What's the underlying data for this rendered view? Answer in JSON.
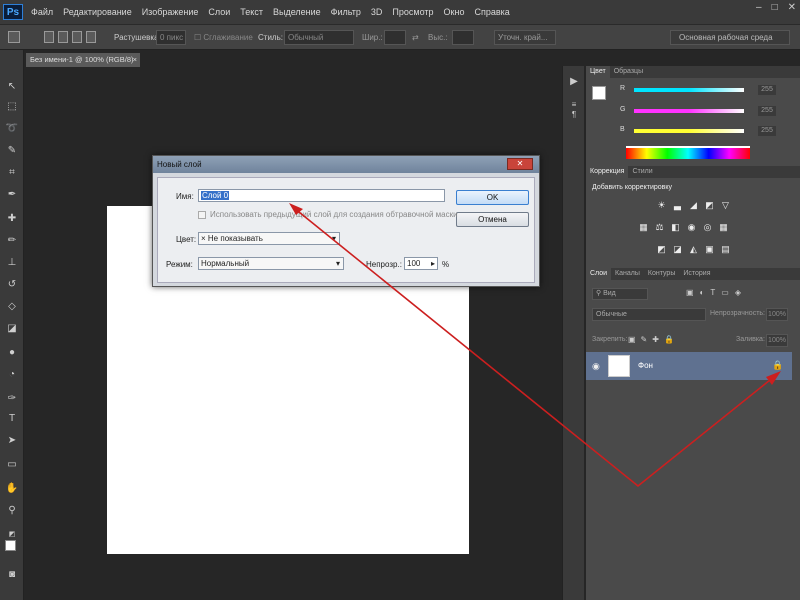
{
  "app": {
    "logo": "Ps"
  },
  "menu": [
    "Файл",
    "Редактирование",
    "Изображение",
    "Слои",
    "Текст",
    "Выделение",
    "Фильтр",
    "3D",
    "Просмотр",
    "Окно",
    "Справка"
  ],
  "window_controls": {
    "minimize": "–",
    "maximize": "□",
    "close": "✕"
  },
  "options_bar": {
    "feather_label": "Растушевка:",
    "feather_value": "0 пикс",
    "antialias_label": "Сглаживание",
    "style_label": "Стиль:",
    "style_value": "Обычный",
    "width_label": "Шир.:",
    "height_label": "Выс.:",
    "refine_button": "Уточн. край...",
    "workspace": "Основная рабочая среда"
  },
  "document_tab": {
    "title": "Без имени-1 @ 100% (RGB/8)",
    "close": "×"
  },
  "color_panel": {
    "tabs": [
      "Цвет",
      "Образцы"
    ],
    "sliders": [
      {
        "label": "R",
        "value": "255",
        "gradient": "#00e5ff"
      },
      {
        "label": "G",
        "value": "255",
        "gradient": "#ff33ff"
      },
      {
        "label": "B",
        "value": "255",
        "gradient": "#ffff33"
      }
    ]
  },
  "adjustments_panel": {
    "tabs": [
      "Коррекция",
      "Стили"
    ],
    "title": "Добавить корректировку"
  },
  "layers_panel": {
    "tabs": [
      "Слои",
      "Каналы",
      "Контуры",
      "История"
    ],
    "filter": "Вид",
    "blend_mode": "Обычные",
    "opacity_label": "Непрозрачность:",
    "opacity_value": "100%",
    "lock_label": "Закрепить:",
    "fill_label": "Заливка:",
    "fill_value": "100%",
    "layers": [
      {
        "name": "Фон",
        "locked": true
      }
    ]
  },
  "dialog": {
    "title": "Новый слой",
    "close": "✕",
    "name_label": "Имя:",
    "name_value": "Слой 0",
    "clip_checkbox_label": "Использовать предыдущий слой для создания обтравочной маски",
    "color_label": "Цвет:",
    "color_value": "Не показывать",
    "color_mark": "×",
    "mode_label": "Режим:",
    "mode_value": "Нормальный",
    "opacity_label": "Непрозр.:",
    "opacity_value": "100",
    "opacity_unit": "%",
    "ok_button": "OK",
    "cancel_button": "Отмена"
  },
  "annotation": {
    "color": "#cc1f1f"
  }
}
